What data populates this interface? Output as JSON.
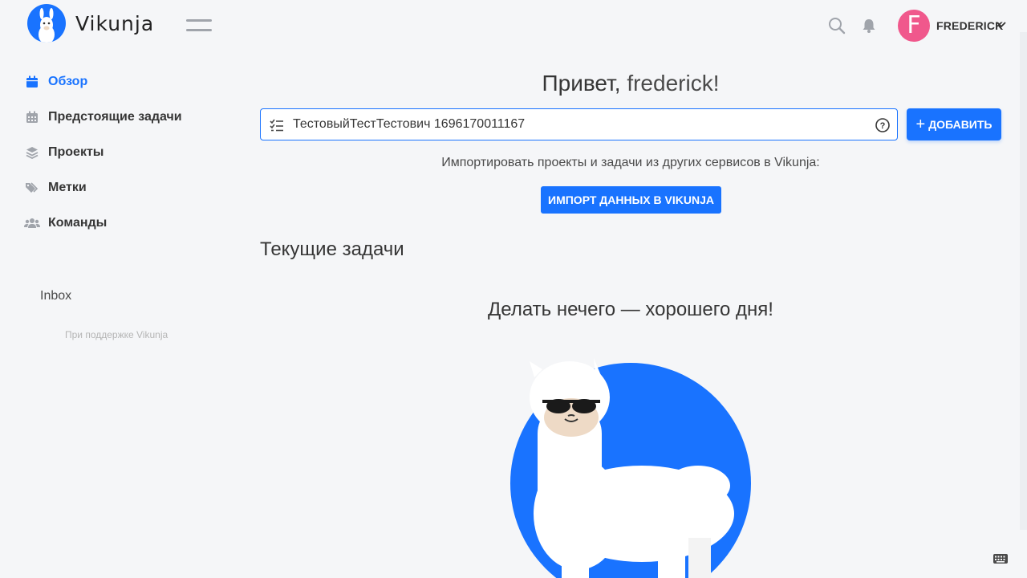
{
  "brand": {
    "name": "Vikunja"
  },
  "header": {
    "username": "FREDERICK",
    "avatar_letter": "F",
    "avatar_color": "#f0588c",
    "icons": [
      "search-icon",
      "bell-icon",
      "chevron-down-icon"
    ]
  },
  "sidebar": {
    "items": [
      {
        "label": "Обзор",
        "icon": "calendar-icon",
        "active": true
      },
      {
        "label": "Предстоящие задачи",
        "icon": "calendar-grid-icon",
        "active": false
      },
      {
        "label": "Проекты",
        "icon": "layers-icon",
        "active": false
      },
      {
        "label": "Метки",
        "icon": "tags-icon",
        "active": false
      },
      {
        "label": "Команды",
        "icon": "users-icon",
        "active": false
      }
    ],
    "projects": [
      "Inbox"
    ],
    "powered_by": "При поддержке Vikunja"
  },
  "main": {
    "greeting_prefix": "Привет, ",
    "greeting_name": "frederick!",
    "task_input": {
      "value": "ТестовыйТестТестович 1696170011167",
      "placeholder": ""
    },
    "add_button": "ДОБАВИТЬ",
    "import_text": "Импортировать проекты и задачи из других сервисов в Vikunja:",
    "import_button": "ИМПОРТ ДАННЫХ В VIKUNJA",
    "current_tasks_title": "Текущие задачи",
    "empty_message": "Делать нечего — хорошего дня!"
  },
  "colors": {
    "accent": "#1973ff",
    "background": "#f5f6f8",
    "icon_gray": "#a0a4ab"
  }
}
